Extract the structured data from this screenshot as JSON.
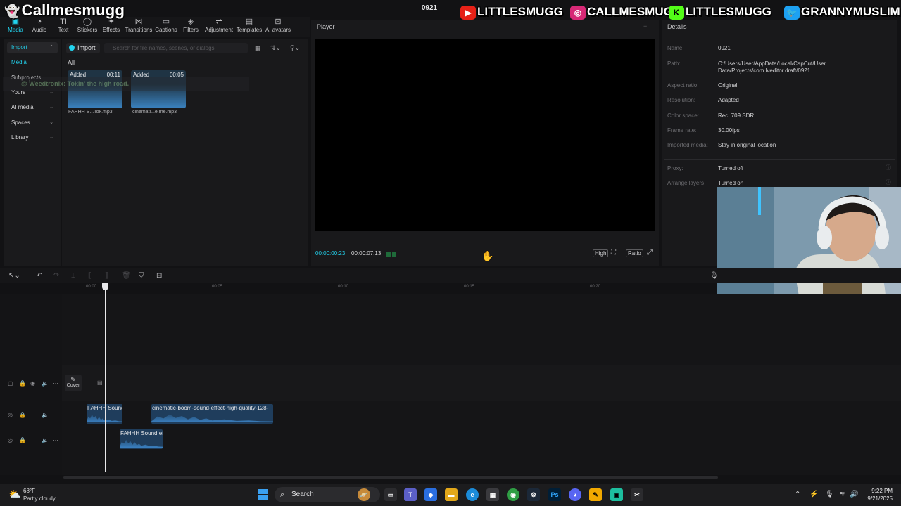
{
  "stream": {
    "name": "Callmesmugg",
    "socials": [
      {
        "badge": "▶",
        "color": "#e62117",
        "label": "LITTLESMUGG"
      },
      {
        "badge": "◎",
        "color": "#d62976",
        "label": "CALLMESMUGG"
      },
      {
        "badge": "K",
        "color": "#53fc18",
        "label": "LITTLESMUGG"
      },
      {
        "badge": "🐦",
        "color": "#1da1f2",
        "label": "GRANNYMUSLIM"
      }
    ],
    "chat_line": "@ Weedtronix: Tokin' the high road."
  },
  "project_title": "0921",
  "toolbar": {
    "tools": [
      {
        "label": "Media",
        "icon": "▣",
        "icon_name": "media-icon",
        "active": true
      },
      {
        "label": "Audio",
        "icon": "◔",
        "icon_name": "audio-icon"
      },
      {
        "label": "Text",
        "icon": "TI",
        "icon_name": "text-icon"
      },
      {
        "label": "Stickers",
        "icon": "◯",
        "icon_name": "stickers-icon"
      },
      {
        "label": "Effects",
        "icon": "✦",
        "icon_name": "effects-icon"
      },
      {
        "label": "Transitions",
        "icon": "⋈",
        "icon_name": "transitions-icon"
      },
      {
        "label": "Captions",
        "icon": "▭",
        "icon_name": "captions-icon"
      },
      {
        "label": "Filters",
        "icon": "◈",
        "icon_name": "filters-icon"
      },
      {
        "label": "Adjustment",
        "icon": "⇌",
        "icon_name": "adjustment-icon"
      },
      {
        "label": "Templates",
        "icon": "▤",
        "icon_name": "templates-icon"
      },
      {
        "label": "AI avatars",
        "icon": "⊡",
        "icon_name": "ai-avatars-icon"
      }
    ]
  },
  "leftnav": {
    "items": [
      {
        "label": "Import",
        "chev": "⌃",
        "selected": true
      },
      {
        "label": "Media",
        "sub": true
      },
      {
        "label": "Subprojects"
      },
      {
        "label": "Yours",
        "chev": "⌄"
      },
      {
        "label": "AI media",
        "chev": "⌄"
      },
      {
        "label": "Spaces",
        "chev": "⌄"
      },
      {
        "label": "Library",
        "chev": "⌄"
      }
    ]
  },
  "media": {
    "import_label": "Import",
    "search_placeholder": "Search for file names, scenes, or dialogs",
    "all_tab": "All",
    "clips": [
      {
        "added": "Added",
        "duration": "00:11",
        "name": "FAHHH S...Tok.mp3"
      },
      {
        "added": "Added",
        "duration": "00:05",
        "name": "cinemati...e.me.mp3"
      }
    ]
  },
  "player": {
    "title": "Player",
    "current_time": "00:00:00:23",
    "total_time": "00:00:07:13",
    "quality": "High",
    "ratio": "Ratio"
  },
  "details": {
    "title": "Details",
    "rows": [
      {
        "key": "Name:",
        "value": "0921"
      },
      {
        "key": "Path:",
        "value": "C:/Users/User/AppData/Local/CapCut/User Data/Projects/com.lveditor.draft/0921"
      },
      {
        "key": "Aspect ratio:",
        "value": "Original"
      },
      {
        "key": "Resolution:",
        "value": "Adapted"
      },
      {
        "key": "Color space:",
        "value": "Rec. 709 SDR"
      },
      {
        "key": "Frame rate:",
        "value": "30.00fps"
      },
      {
        "key": "Imported media:",
        "value": "Stay in original location"
      },
      {
        "key": "Proxy:",
        "value": "Turned off"
      },
      {
        "key": "Arrange layers",
        "value": "Turned on"
      }
    ]
  },
  "timeline": {
    "ticks": [
      "00:00",
      "00:05",
      "00:10",
      "00:15",
      "00:20"
    ],
    "cover_label": "Cover",
    "clips": [
      {
        "label": "FAHHH Sound"
      },
      {
        "label": "cinematic-boom-sound-effect-high-quality-128-"
      },
      {
        "label": "FAHHH Sound ef"
      }
    ]
  },
  "taskbar": {
    "temp": "68°F",
    "weather": "Partly cloudy",
    "search": "Search",
    "time": "9:22 PM",
    "date": "9/21/2025"
  }
}
